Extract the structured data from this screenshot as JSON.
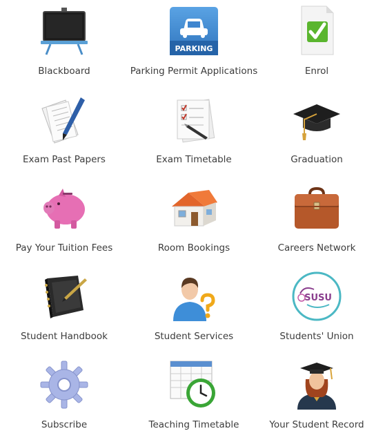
{
  "tiles": [
    {
      "label": "Blackboard",
      "icon": "blackboard-icon"
    },
    {
      "label": "Parking Permit Applications",
      "icon": "parking-icon",
      "icon_text": "PARKING"
    },
    {
      "label": "Enrol",
      "icon": "enrol-checkmark-icon"
    },
    {
      "label": "Exam Past Papers",
      "icon": "papers-pen-icon"
    },
    {
      "label": "Exam Timetable",
      "icon": "checklist-icon"
    },
    {
      "label": "Graduation",
      "icon": "mortarboard-icon"
    },
    {
      "label": "Pay Your Tuition Fees",
      "icon": "piggy-bank-icon"
    },
    {
      "label": "Room Bookings",
      "icon": "house-icon"
    },
    {
      "label": "Careers Network",
      "icon": "briefcase-icon"
    },
    {
      "label": "Student Handbook",
      "icon": "notebook-pen-icon"
    },
    {
      "label": "Student Services",
      "icon": "person-help-icon"
    },
    {
      "label": "Students' Union",
      "icon": "susu-logo-icon",
      "icon_text": "SUSU"
    },
    {
      "label": "Subscribe",
      "icon": "gear-icon"
    },
    {
      "label": "Teaching Timetable",
      "icon": "calendar-clock-icon"
    },
    {
      "label": "Your Student Record",
      "icon": "graduate-person-icon"
    }
  ],
  "colors": {
    "label_text": "#3c3c3c",
    "parking_blue": "#3f86cf",
    "enrol_green": "#5ab52e",
    "piggy_pink": "#e66fb4",
    "briefcase_brown": "#b5582a",
    "susu_teal": "#4bb8c4",
    "susu_purple": "#8a3e8e"
  }
}
